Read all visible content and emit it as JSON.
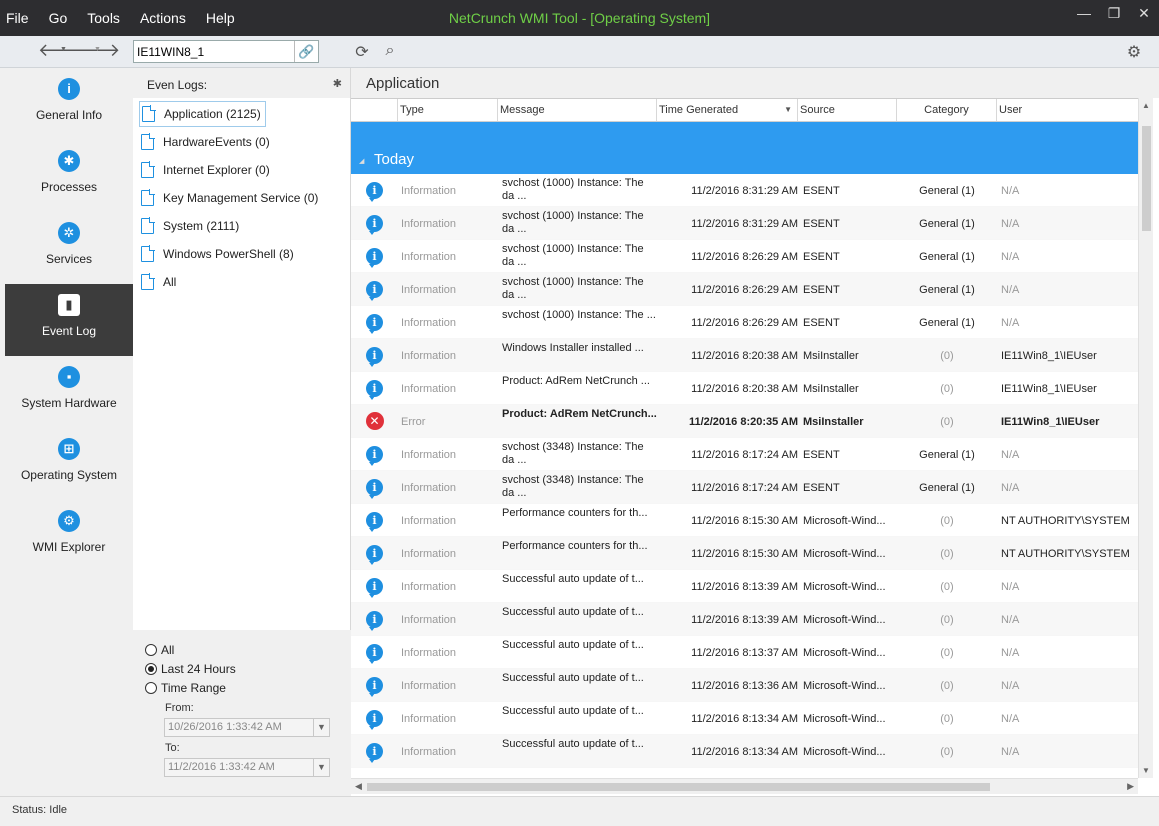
{
  "app": {
    "title": "NetCrunch WMI Tool - [Operating System]",
    "menu": [
      "File",
      "Go",
      "Tools",
      "Actions",
      "Help"
    ],
    "window_controls": [
      "—",
      "❐",
      "✕"
    ]
  },
  "toolbar": {
    "host_value": "IE11WIN8_1"
  },
  "nav": {
    "items": [
      {
        "label": "General Info",
        "icon": "info-icon",
        "glyph": "i"
      },
      {
        "label": "Processes",
        "icon": "gear-icon",
        "glyph": "✱"
      },
      {
        "label": "Services",
        "icon": "gears-icon",
        "glyph": "✲"
      },
      {
        "label": "Event Log",
        "icon": "document-icon",
        "glyph": "▮"
      },
      {
        "label": "System Hardware",
        "icon": "chip-icon",
        "glyph": "▪"
      },
      {
        "label": "Operating System",
        "icon": "windows-icon",
        "glyph": "⊞"
      },
      {
        "label": "WMI Explorer",
        "icon": "search-gear-icon",
        "glyph": "⚙"
      }
    ]
  },
  "logs": {
    "header": "Even Logs:",
    "items": [
      "Application (2125)",
      "HardwareEvents (0)",
      "Internet Explorer (0)",
      "Key Management Service (0)",
      "System (2111)",
      "Windows PowerShell (8)",
      "All"
    ],
    "range": {
      "options": [
        "All",
        "Last 24 Hours",
        "Time Range"
      ],
      "from_label": "From:",
      "from_value": "10/26/2016 1:33:42 AM",
      "to_label": "To:",
      "to_value": "11/2/2016 1:33:42 AM"
    }
  },
  "main": {
    "title": "Application",
    "columns": [
      "Type",
      "Message",
      "Time Generated",
      "Source",
      "Category",
      "User"
    ],
    "group": "Today",
    "rows": [
      {
        "type": "Information",
        "msg": "svchost (1000) Instance: The da ...",
        "time": "11/2/2016 8:31:29 AM",
        "src": "ESENT",
        "cat": "General (1)",
        "user": "N/A"
      },
      {
        "type": "Information",
        "msg": "svchost (1000) Instance: The da ...",
        "time": "11/2/2016 8:31:29 AM",
        "src": "ESENT",
        "cat": "General (1)",
        "user": "N/A"
      },
      {
        "type": "Information",
        "msg": "svchost (1000) Instance: The da ...",
        "time": "11/2/2016 8:26:29 AM",
        "src": "ESENT",
        "cat": "General (1)",
        "user": "N/A"
      },
      {
        "type": "Information",
        "msg": "svchost (1000) Instance: The da ...",
        "time": "11/2/2016 8:26:29 AM",
        "src": "ESENT",
        "cat": "General (1)",
        "user": "N/A"
      },
      {
        "type": "Information",
        "msg": "svchost (1000) Instance: The ...",
        "time": "11/2/2016 8:26:29 AM",
        "src": "ESENT",
        "cat": "General (1)",
        "user": "N/A"
      },
      {
        "type": "Information",
        "msg": "Windows Installer installed ...",
        "time": "11/2/2016 8:20:38 AM",
        "src": "MsiInstaller",
        "cat": "(0)",
        "user": "IE11Win8_1\\IEUser"
      },
      {
        "type": "Information",
        "msg": "Product: AdRem NetCrunch ...",
        "time": "11/2/2016 8:20:38 AM",
        "src": "MsiInstaller",
        "cat": "(0)",
        "user": "IE11Win8_1\\IEUser"
      },
      {
        "type": "Error",
        "msg": "Product: AdRem NetCrunch...",
        "time": "11/2/2016 8:20:35 AM",
        "src": "MsiInstaller",
        "cat": "(0)",
        "user": "IE11Win8_1\\IEUser"
      },
      {
        "type": "Information",
        "msg": "svchost (3348) Instance: The da ...",
        "time": "11/2/2016 8:17:24 AM",
        "src": "ESENT",
        "cat": "General (1)",
        "user": "N/A"
      },
      {
        "type": "Information",
        "msg": "svchost (3348) Instance: The da ...",
        "time": "11/2/2016 8:17:24 AM",
        "src": "ESENT",
        "cat": "General (1)",
        "user": "N/A"
      },
      {
        "type": "Information",
        "msg": "Performance counters for th...",
        "time": "11/2/2016 8:15:30 AM",
        "src": "Microsoft-Wind...",
        "cat": "(0)",
        "user": "NT AUTHORITY\\SYSTEM"
      },
      {
        "type": "Information",
        "msg": "Performance counters for th...",
        "time": "11/2/2016 8:15:30 AM",
        "src": "Microsoft-Wind...",
        "cat": "(0)",
        "user": "NT AUTHORITY\\SYSTEM"
      },
      {
        "type": "Information",
        "msg": "Successful auto update of t...",
        "time": "11/2/2016 8:13:39 AM",
        "src": "Microsoft-Wind...",
        "cat": "(0)",
        "user": "N/A"
      },
      {
        "type": "Information",
        "msg": "Successful auto update of t...",
        "time": "11/2/2016 8:13:39 AM",
        "src": "Microsoft-Wind...",
        "cat": "(0)",
        "user": "N/A"
      },
      {
        "type": "Information",
        "msg": "Successful auto update of t...",
        "time": "11/2/2016 8:13:37 AM",
        "src": "Microsoft-Wind...",
        "cat": "(0)",
        "user": "N/A"
      },
      {
        "type": "Information",
        "msg": "Successful auto update of t...",
        "time": "11/2/2016 8:13:36 AM",
        "src": "Microsoft-Wind...",
        "cat": "(0)",
        "user": "N/A"
      },
      {
        "type": "Information",
        "msg": "Successful auto update of t...",
        "time": "11/2/2016 8:13:34 AM",
        "src": "Microsoft-Wind...",
        "cat": "(0)",
        "user": "N/A"
      },
      {
        "type": "Information",
        "msg": "Successful auto update of t...",
        "time": "11/2/2016 8:13:34 AM",
        "src": "Microsoft-Wind...",
        "cat": "(0)",
        "user": "N/A"
      }
    ]
  },
  "status": {
    "text": "Status: Idle"
  }
}
